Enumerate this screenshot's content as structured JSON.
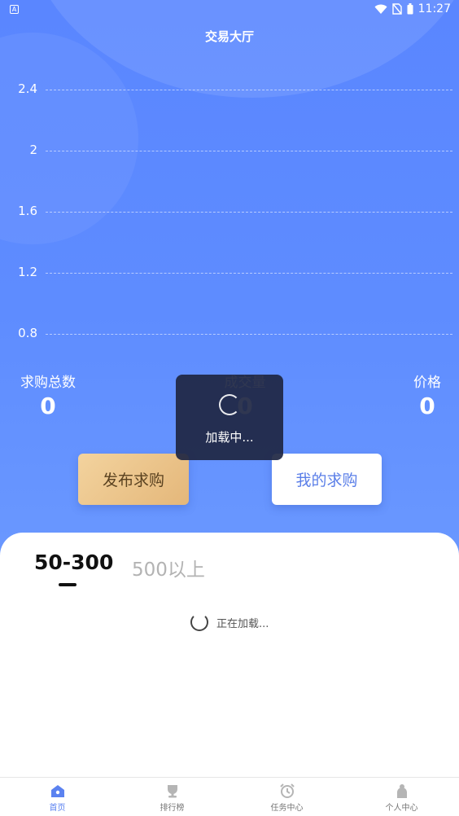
{
  "status_bar": {
    "time": "11:27",
    "notification_icon": "A"
  },
  "header": {
    "title": "交易大厅"
  },
  "chart": {
    "y_ticks": [
      "2.4",
      "2",
      "1.6",
      "1.2",
      "0.8"
    ]
  },
  "stats": {
    "total_requests": {
      "label": "求购总数",
      "value": "0"
    },
    "volume": {
      "label": "成交量",
      "value": "0"
    },
    "price": {
      "label": "价格",
      "value": "0"
    }
  },
  "actions": {
    "publish": "发布求购",
    "mine": "我的求购"
  },
  "toast": {
    "text": "加载中..."
  },
  "tabs": [
    {
      "label": "50-300",
      "active": true
    },
    {
      "label": "500以上",
      "active": false
    }
  ],
  "list": {
    "loading_text": "正在加载..."
  },
  "tabbar": [
    {
      "label": "首页",
      "icon": "home-icon",
      "active": true
    },
    {
      "label": "排行榜",
      "icon": "trophy-icon",
      "active": false
    },
    {
      "label": "任务中心",
      "icon": "alarm-clock-icon",
      "active": false
    },
    {
      "label": "个人中心",
      "icon": "person-icon",
      "active": false
    }
  ],
  "colors": {
    "accent": "#5b82f0",
    "hero_bg": "#5e8cff",
    "publish_button": "#e8be82"
  }
}
